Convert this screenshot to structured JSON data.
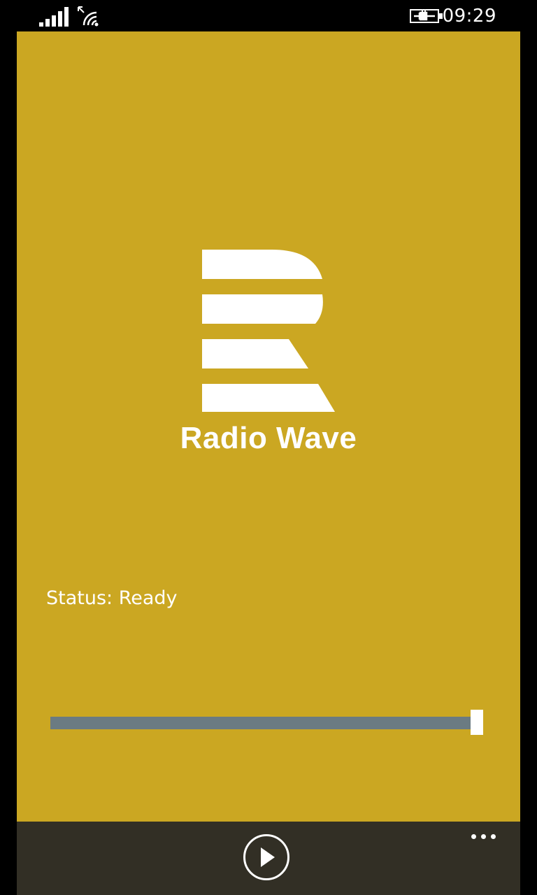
{
  "status_bar": {
    "time": "09:29",
    "icons": [
      "signal-strength-icon",
      "wifi-icon",
      "battery-charging-icon"
    ]
  },
  "app": {
    "station_name": "Radio Wave",
    "status_text": "Status: Ready",
    "background_color": "#CBA722",
    "appbar_color": "#322F25",
    "volume_fraction": 1.0
  },
  "app_bar": {
    "buttons": [
      "play-icon",
      "more-icon"
    ]
  }
}
